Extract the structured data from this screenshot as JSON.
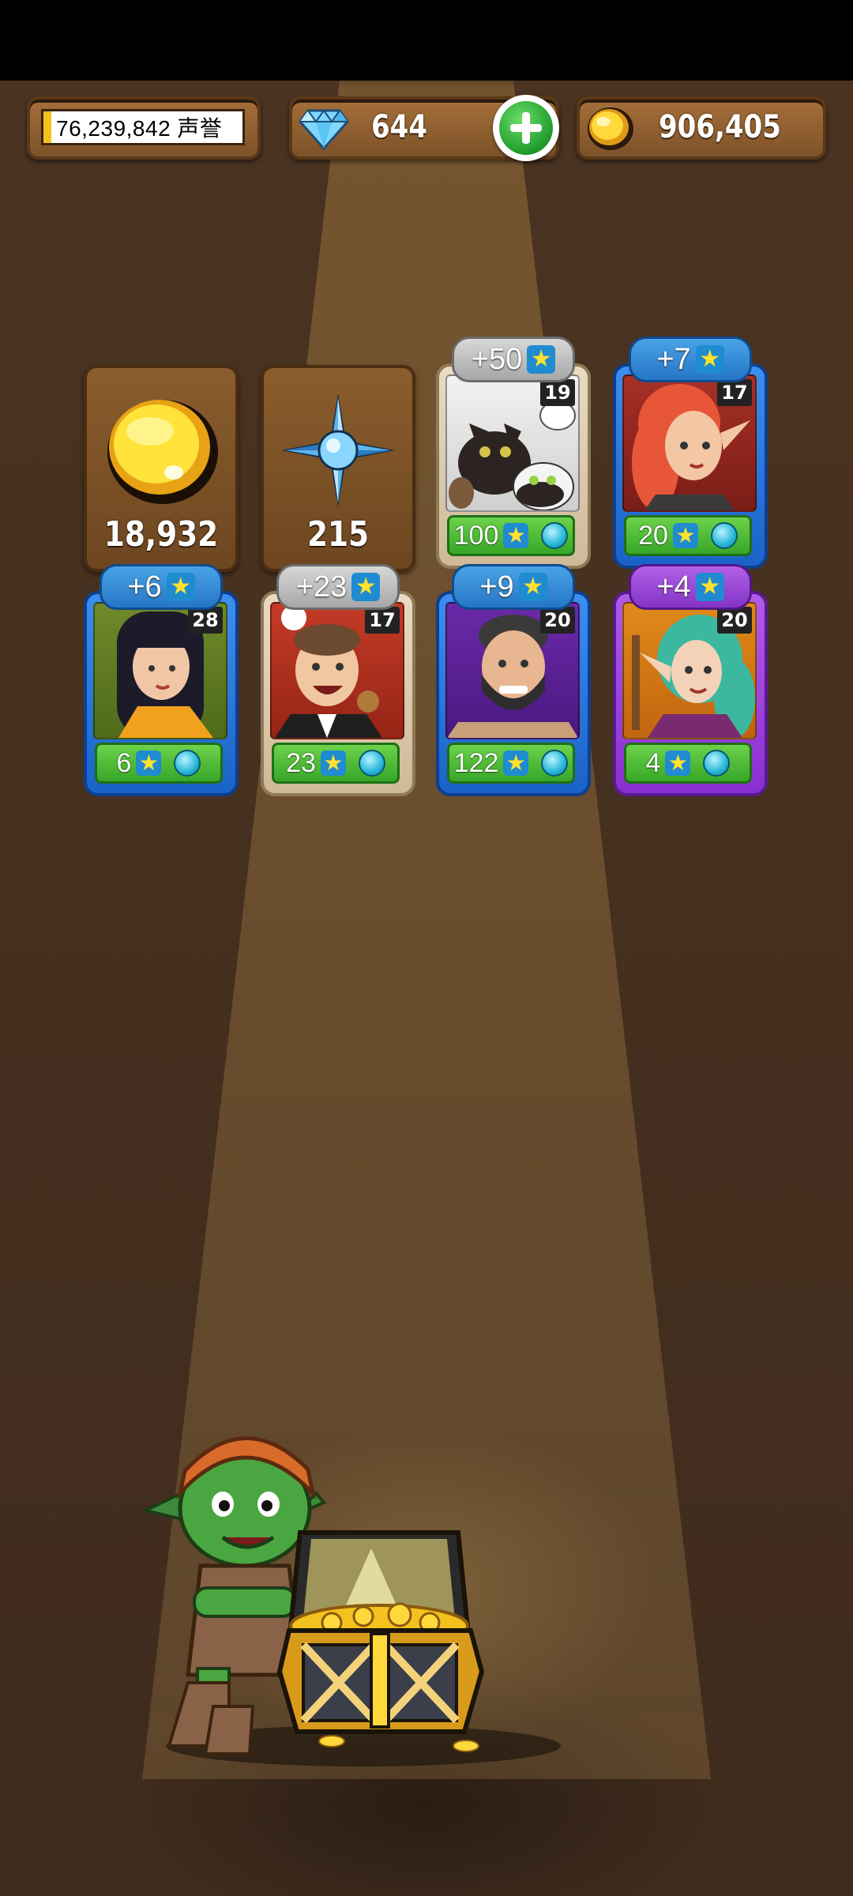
{
  "top_bar": {
    "fame": "76,239,842 声誉",
    "gems": "644",
    "gold": "906,405"
  },
  "resource_cards": [
    {
      "name": "gold",
      "value": "18,932"
    },
    {
      "name": "compass",
      "value": "215"
    }
  ],
  "hero_cards": [
    {
      "bonus": "+50",
      "level": "19",
      "stat": "100",
      "frame": "tan",
      "subject": "cats"
    },
    {
      "bonus": "+7",
      "level": "17",
      "stat": "20",
      "frame": "blue",
      "subject": "red-haired elf"
    },
    {
      "bonus": "+6",
      "level": "28",
      "stat": "6",
      "frame": "blue",
      "subject": "dark-haired woman"
    },
    {
      "bonus": "+23",
      "level": "17",
      "stat": "23",
      "frame": "tan",
      "subject": "chef"
    },
    {
      "bonus": "+9",
      "level": "20",
      "stat": "122",
      "frame": "blue",
      "subject": "bearded man"
    },
    {
      "bonus": "+4",
      "level": "20",
      "stat": "4",
      "frame": "purple",
      "subject": "green-haired elf"
    }
  ],
  "colors": {
    "background": "#3d2a1c",
    "stat_green": "#37a628",
    "frame_blue": "#1a62c8",
    "frame_purple": "#8a2fd0",
    "frame_tan": "#cfb998"
  }
}
